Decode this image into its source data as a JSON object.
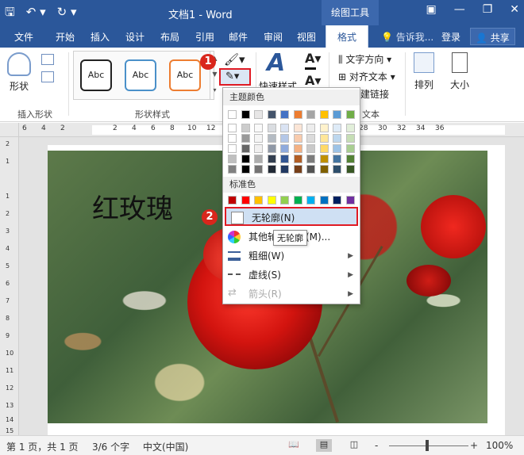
{
  "titlebar": {
    "save_icon": "save-icon",
    "undo_icon": "undo-icon",
    "redo_icon": "redo-icon",
    "doc_title": "文档1 - Word",
    "context_tab_group": "绘图工具",
    "minimize_icon": "minimize-icon",
    "restore_icon": "restore-icon",
    "close_icon": "close-icon",
    "ribbon_display_icon": "ribbon-display-icon"
  },
  "tabs": [
    "文件",
    "开始",
    "插入",
    "设计",
    "布局",
    "引用",
    "邮件",
    "审阅",
    "视图",
    "格式"
  ],
  "active_tab": "格式",
  "tellme": "告诉我...",
  "login": "登录",
  "share": "共享",
  "ribbon": {
    "insert_shapes": {
      "shape_label": "形状",
      "group_label": "插入形状"
    },
    "shape_styles": {
      "presets": [
        "Abc",
        "Abc",
        "Abc"
      ],
      "preset_colors": [
        "#222222",
        "#4a90c9",
        "#ed7d31"
      ],
      "group_label": "形状样式"
    },
    "wordart": {
      "quick_styles": "快速样式"
    },
    "text": {
      "direction": "文字方向",
      "align": "对齐文本",
      "link": "建链接",
      "group_label": "文本"
    },
    "arrange": "排列",
    "size": "大小"
  },
  "callouts": [
    "1",
    "2"
  ],
  "ruler": {
    "h_ticks": [
      "6",
      "4",
      "2",
      "2",
      "4",
      "6",
      "8",
      "10",
      "12",
      "14",
      "16",
      "18",
      "20",
      "22",
      "24",
      "26",
      "28",
      "30",
      "32",
      "34",
      "36"
    ],
    "v_ticks": [
      "2",
      "1",
      "1",
      "2",
      "3",
      "4",
      "5",
      "6",
      "7",
      "8",
      "9",
      "10",
      "11",
      "12",
      "13",
      "14",
      "15"
    ]
  },
  "document": {
    "text": "红玫瑰"
  },
  "outline_menu": {
    "theme_header": "主题颜色",
    "standard_header": "标准色",
    "theme_colors": [
      "#ffffff",
      "#000000",
      "#e7e6e6",
      "#44546a",
      "#4472c4",
      "#ed7d31",
      "#a5a5a5",
      "#ffc000",
      "#5b9bd5",
      "#70ad47"
    ],
    "standard_colors": [
      "#c00000",
      "#ff0000",
      "#ffc000",
      "#ffff00",
      "#92d050",
      "#00b050",
      "#00b0f0",
      "#0070c0",
      "#002060",
      "#7030a0"
    ],
    "items": [
      {
        "label": "无轮廓(N)",
        "icon": "no-outline-icon"
      },
      {
        "label": "其他轮廓颜色(M)...",
        "icon": "color-wheel-icon"
      },
      {
        "label": "粗细(W)",
        "icon": "line-weight-icon"
      },
      {
        "label": "虚线(S)",
        "icon": "dash-icon"
      },
      {
        "label": "箭头(R)",
        "icon": "arrow-style-icon"
      }
    ],
    "tooltip": "无轮廓"
  },
  "statusbar": {
    "page": "第 1 页，共 1 页",
    "words": "3/6 个字",
    "language": "中文(中国)",
    "zoom_minus": "-",
    "zoom_plus": "+",
    "zoom": "100%"
  }
}
